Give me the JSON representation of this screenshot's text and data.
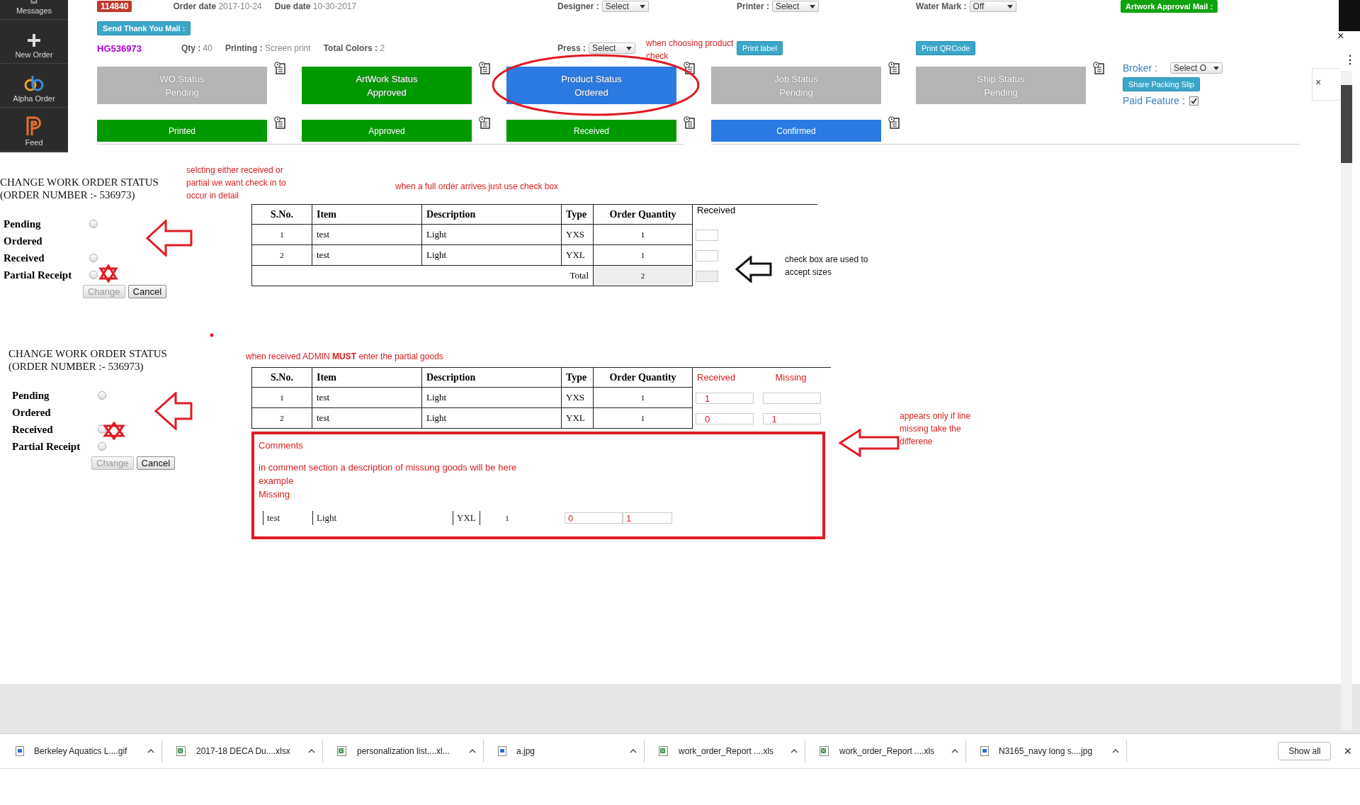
{
  "sidebar": {
    "items": [
      {
        "label": "Messages",
        "kind": "mail"
      },
      {
        "label": "New Order",
        "kind": "plus"
      },
      {
        "label": "Alpha Order",
        "kind": "alpha"
      },
      {
        "label": "Feed",
        "kind": "feed"
      }
    ]
  },
  "order": {
    "number": "114840",
    "code": "HG536973",
    "dates": [
      {
        "label": "Order date",
        "value": "2017-10-24"
      },
      {
        "label": "Due date",
        "value": "10-30-2017"
      }
    ],
    "details": [
      {
        "label": "Qty :",
        "value": "40"
      },
      {
        "label": "Printing :",
        "value": "Screen print"
      },
      {
        "label": "Total Colors :",
        "value": "2"
      }
    ],
    "selects_top": [
      {
        "label": "Designer :",
        "value": "Select"
      },
      {
        "label": "Printer :",
        "value": "Select"
      },
      {
        "label": "Water Mark :",
        "value": "Off"
      }
    ],
    "press": {
      "label": "Press :",
      "value": "Select"
    },
    "buttons": {
      "thank_you": "Send Thank You Mail :",
      "artwork_mail": "Artwork Approval Mail :",
      "print_label": "Print label",
      "print_qr": "Print QRCode"
    }
  },
  "statuses": [
    {
      "title": "WO.Status",
      "value": "Pending",
      "color": "#b5b5b5"
    },
    {
      "title": "ArtWork Status",
      "value": "Approved",
      "color": "#009900"
    },
    {
      "title": "Product Status",
      "value": "Ordered",
      "color": "#2a7ae2"
    },
    {
      "title": "Job Status",
      "value": "Pending",
      "color": "#b5b5b5"
    },
    {
      "title": "Ship Status",
      "value": "Pending",
      "color": "#b5b5b5"
    }
  ],
  "substatuses": [
    {
      "label": "Printed",
      "color": "#009900"
    },
    {
      "label": "Approved",
      "color": "#009900"
    },
    {
      "label": "Received",
      "color": "#009900"
    },
    {
      "label": "Confirmed",
      "color": "#2a7ae2"
    }
  ],
  "side_panel": {
    "broker_label": "Broker :",
    "broker_value": "Select O",
    "share_button": "Share Packing Slip",
    "paid_label": "Paid Feature :",
    "paid_checked": true,
    "close": "×"
  },
  "window": {
    "close": "×",
    "menu": "⋮"
  },
  "forms": [
    {
      "title": "CHANGE WORK ORDER STATUS",
      "subtitle": "(ORDER NUMBER :- 536973)",
      "options": [
        {
          "label": "Pending",
          "has_radio": true,
          "selected": false
        },
        {
          "label": "Ordered",
          "has_radio": false,
          "selected": false
        },
        {
          "label": "Received",
          "has_radio": true,
          "selected": false
        },
        {
          "label": "Partial Receipt",
          "has_radio": true,
          "selected": false
        }
      ],
      "change": "Change",
      "change_disabled": true,
      "cancel": "Cancel",
      "table": {
        "columns": [
          "S.No.",
          "Item",
          "Description",
          "Type",
          "Order Quantity",
          "Received"
        ],
        "rows": [
          {
            "sno": "1",
            "item": "test",
            "description": "Light",
            "type": "YXS",
            "quantity": "1"
          },
          {
            "sno": "2",
            "item": "test",
            "description": "Light",
            "type": "YXL",
            "quantity": "1"
          }
        ],
        "total_label": "Total",
        "total_value": "2"
      }
    },
    {
      "title": "CHANGE WORK ORDER STATUS",
      "subtitle": "(ORDER NUMBER :- 536973)",
      "options": [
        {
          "label": "Pending",
          "has_radio": true,
          "selected": false
        },
        {
          "label": "Ordered",
          "has_radio": false,
          "selected": false
        },
        {
          "label": "Received",
          "has_radio": true,
          "selected": false
        },
        {
          "label": "Partial Receipt",
          "has_radio": true,
          "selected": false
        }
      ],
      "change": "Change",
      "change_disabled": true,
      "cancel": "Cancel",
      "table": {
        "columns": [
          "S.No.",
          "Item",
          "Description",
          "Type",
          "Order Quantity",
          "Received",
          "Missing"
        ],
        "rows": [
          {
            "sno": "1",
            "item": "test",
            "description": "Light",
            "type": "YXS",
            "quantity": "1",
            "received": "1"
          },
          {
            "sno": "2",
            "item": "test",
            "description": "Light",
            "type": "YXL",
            "quantity": "1",
            "received": "0",
            "missing": "1"
          }
        ]
      }
    }
  ],
  "comments": {
    "title": "Comments",
    "lines": [
      "in comment section a description of missung goods will be here",
      "example",
      "Missing"
    ],
    "row": {
      "item": "test",
      "description": "Light",
      "type": "YXL",
      "quantity": "1",
      "received": "0",
      "missing": "1"
    }
  },
  "annotations": [
    {
      "lines": [
        "when choosing product",
        "check"
      ],
      "color": "#d92020"
    },
    {
      "lines": [
        "selcting either received or",
        "partial we want check in to",
        "occur in detail"
      ],
      "color": "#d92020"
    },
    {
      "lines": [
        "when a full order arrives just use check box"
      ],
      "color": "#d92020"
    },
    {
      "lines": [
        "check box are used to",
        "accept sizes"
      ],
      "color": "#111111"
    },
    {
      "lines": [
        "when received ADMIN **MUST** enter the partial goods"
      ],
      "color": "#d92020"
    },
    {
      "lines": [
        "appears only if line",
        "missing take the",
        "differene"
      ],
      "color": "#d92020"
    }
  ],
  "downloads": {
    "items": [
      {
        "name": "Berkeley Aquatics L....gif",
        "kind": "image"
      },
      {
        "name": "2017-18 DECA Du....xlsx",
        "kind": "sheet"
      },
      {
        "name": "personalization list....xl...",
        "kind": "sheet"
      },
      {
        "name": "a.jpg",
        "kind": "image"
      },
      {
        "name": "work_order_Report ....xls",
        "kind": "sheet"
      },
      {
        "name": "work_order_Report ....xls",
        "kind": "sheet"
      },
      {
        "name": "N3165_navy long s....jpg",
        "kind": "image"
      }
    ],
    "show_all": "Show all",
    "close": "×"
  }
}
